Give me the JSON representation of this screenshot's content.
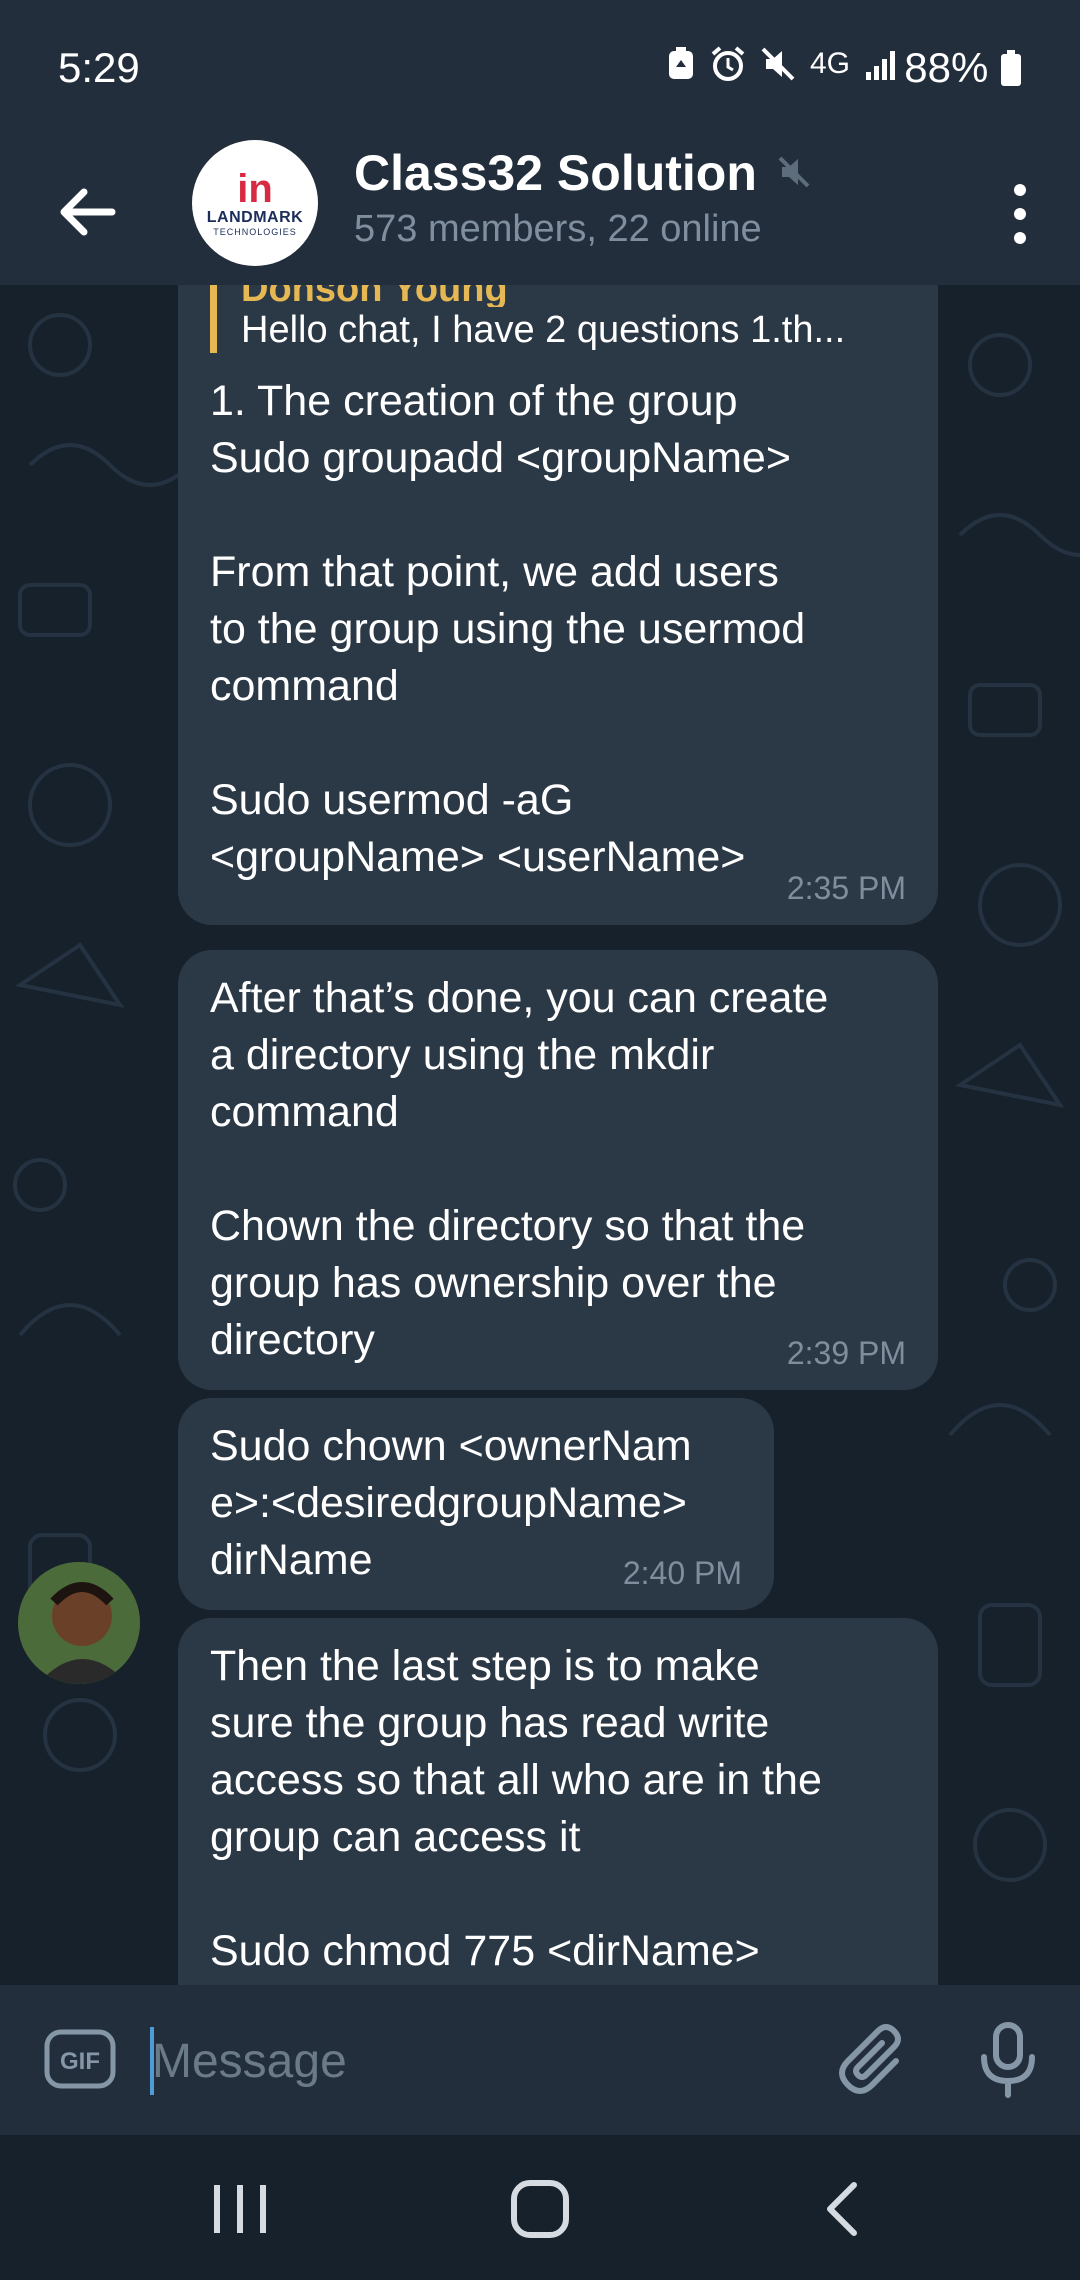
{
  "status_bar": {
    "time": "5:29",
    "network": "4G",
    "battery": "88%"
  },
  "header": {
    "title": "Class32 Solution",
    "subtitle": "573 members, 22 online",
    "avatar_logo_mark": "in",
    "avatar_logo_name": "LANDMARK",
    "avatar_logo_sub": "TECHNOLOGIES"
  },
  "messages": [
    {
      "reply_to_name": "Donson Young",
      "reply_to_text": "Hello chat, I have 2 questions   1.th...",
      "text": "1. The creation of the group\nSudo groupadd <groupName>\n\nFrom that point, we add users\nto the group using the usermod\ncommand\n\nSudo usermod -aG\n<groupName> <userName>",
      "time": "2:35 PM"
    },
    {
      "text": "After that’s done, you can create\na directory using the mkdir\ncommand\n\nChown the directory so that the\ngroup has ownership over the\ndirectory",
      "time": "2:39 PM"
    },
    {
      "text": "Sudo chown <ownerNam\ne>:<desiredgroupName>\ndirName",
      "time": "2:40 PM"
    },
    {
      "text": "Then the last step is to make\nsure the group has read write\naccess so that all who are in the\ngroup can access it\n\nSudo chmod 775 <dirName>"
    }
  ],
  "input": {
    "placeholder": "Message",
    "value": "",
    "gif_label": "GIF"
  },
  "colors": {
    "header_bg": "#232e3c",
    "chat_bg": "#17212b",
    "bubble_bg": "#2b3846",
    "reply_accent": "#e6b854",
    "cursor": "#4e9bd6"
  }
}
